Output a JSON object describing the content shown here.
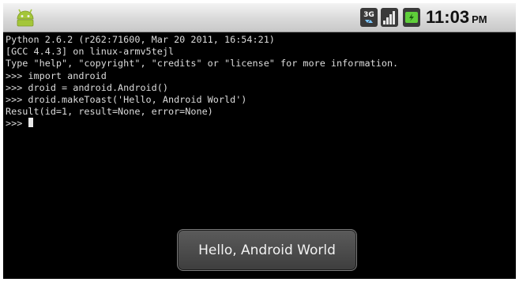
{
  "status_bar": {
    "notification_icon": "android-robot-icon",
    "network_badge": "3g-icon",
    "signal_icon": "signal-strength-icon",
    "battery_icon": "battery-charging-icon",
    "time": "11:03",
    "ampm": "PM"
  },
  "terminal": {
    "lines": [
      "Python 2.6.2 (r262:71600, Mar 20 2011, 16:54:21)",
      "[GCC 4.4.3] on linux-armv5tejl",
      "Type \"help\", \"copyright\", \"credits\" or \"license\" for more information.",
      ">>> import android",
      ">>> droid = android.Android()",
      ">>> droid.makeToast('Hello, Android World')",
      "Result(id=1, result=None, error=None)"
    ],
    "prompt": ">>> "
  },
  "toast": {
    "message": "Hello, Android World"
  },
  "colors": {
    "terminal_bg": "#000000",
    "terminal_fg": "#dcdcdc",
    "android_green": "#a4c639",
    "toast_bg": "#4a4a4a"
  }
}
